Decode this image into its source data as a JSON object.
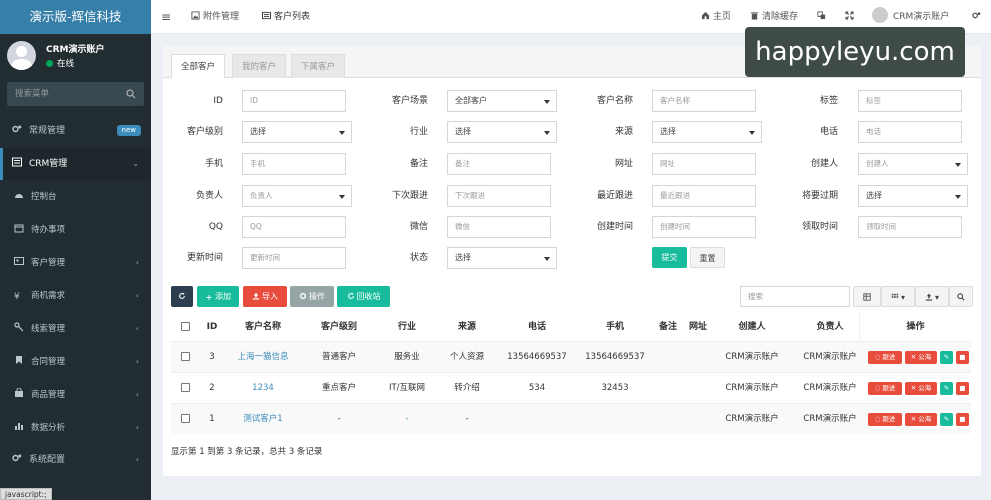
{
  "app_title": "演示版-辉信科技",
  "user": {
    "name": "CRM演示账户",
    "status": "在线"
  },
  "sidebar": {
    "search_placeholder": "搜索菜单",
    "items": [
      {
        "label": "常规管理",
        "badge": "new"
      },
      {
        "label": "CRM管理"
      },
      {
        "label": "控制台"
      },
      {
        "label": "待办事项"
      },
      {
        "label": "客户管理"
      },
      {
        "label": "商机需求"
      },
      {
        "label": "线索管理"
      },
      {
        "label": "合同管理"
      },
      {
        "label": "商品管理"
      },
      {
        "label": "数据分析"
      },
      {
        "label": "系统配置"
      }
    ]
  },
  "topbar": {
    "tabs": [
      "附件管理",
      "客户列表"
    ],
    "home": "主页",
    "clear_cache": "清除缓存",
    "user": "CRM演示账户"
  },
  "subtabs": [
    "全部客户",
    "我的客户",
    "下属客户"
  ],
  "filters": {
    "id": {
      "label": "ID",
      "placeholder": "ID"
    },
    "scene": {
      "label": "客户场景",
      "value": "全部客户"
    },
    "name": {
      "label": "客户名称",
      "placeholder": "客户名称"
    },
    "tag": {
      "label": "标签",
      "placeholder": "标签"
    },
    "level": {
      "label": "客户级别",
      "value": "选择"
    },
    "industry": {
      "label": "行业",
      "value": "选择"
    },
    "source": {
      "label": "来源",
      "value": "选择"
    },
    "phone": {
      "label": "电话",
      "placeholder": "电话"
    },
    "mobile": {
      "label": "手机",
      "placeholder": "手机"
    },
    "remark": {
      "label": "备注",
      "placeholder": "备注"
    },
    "website": {
      "label": "网址",
      "placeholder": "网址"
    },
    "creator": {
      "label": "创建人",
      "value": "创建人"
    },
    "owner": {
      "label": "负责人",
      "value": "负责人"
    },
    "next_follow": {
      "label": "下次跟进",
      "placeholder": "下次跟进"
    },
    "last_follow": {
      "label": "最近跟进",
      "placeholder": "最近跟进"
    },
    "expire": {
      "label": "将要过期",
      "value": "选择"
    },
    "qq": {
      "label": "QQ",
      "placeholder": "QQ"
    },
    "wechat": {
      "label": "微信",
      "placeholder": "微信"
    },
    "created": {
      "label": "创建时间",
      "placeholder": "创建时间"
    },
    "claimed": {
      "label": "领取时间",
      "placeholder": "领取时间"
    },
    "updated": {
      "label": "更新时间",
      "placeholder": "更新时间"
    },
    "state": {
      "label": "状态",
      "value": "选择"
    },
    "submit": "提交",
    "reset": "重置"
  },
  "toolbar": {
    "add": "添加",
    "import": "导入",
    "operate": "操作",
    "recycle": "回收站",
    "search_placeholder": "搜索"
  },
  "table": {
    "headers": [
      "ID",
      "客户名称",
      "客户级别",
      "行业",
      "来源",
      "电话",
      "手机",
      "备注",
      "网址",
      "创建人",
      "负责人",
      "操作"
    ],
    "rows": [
      {
        "id": "3",
        "name": "上海一猫信息",
        "level": "普通客户",
        "industry": "服务业",
        "source": "个人资源",
        "phone": "13564669537",
        "mobile": "13564669537",
        "remark": "",
        "website": "",
        "creator": "CRM演示账户",
        "owner": "CRM演示账户"
      },
      {
        "id": "2",
        "name": "1234",
        "level": "重点客户",
        "industry": "IT/互联网",
        "source": "转介绍",
        "phone": "534",
        "mobile": "32453",
        "remark": "",
        "website": "",
        "creator": "CRM演示账户",
        "owner": "CRM演示账户"
      },
      {
        "id": "1",
        "name": "测试客户1",
        "level": "-",
        "industry": "-",
        "source": "-",
        "phone": "",
        "mobile": "",
        "remark": "",
        "website": "",
        "creator": "CRM演示账户",
        "owner": "CRM演示账户"
      }
    ],
    "action_labels": {
      "follow": "跟进",
      "public": "公海"
    },
    "footer": "显示第 1 到第 3 条记录，总共 3 条记录"
  },
  "watermark": "happyleyu.com",
  "status_bar": "javascript:;",
  "colors": {
    "primary": "#3c8dbc",
    "success": "#00a65a",
    "danger": "#dd4b39",
    "sidebar": "#222d32",
    "teal": "#18bc9c"
  }
}
